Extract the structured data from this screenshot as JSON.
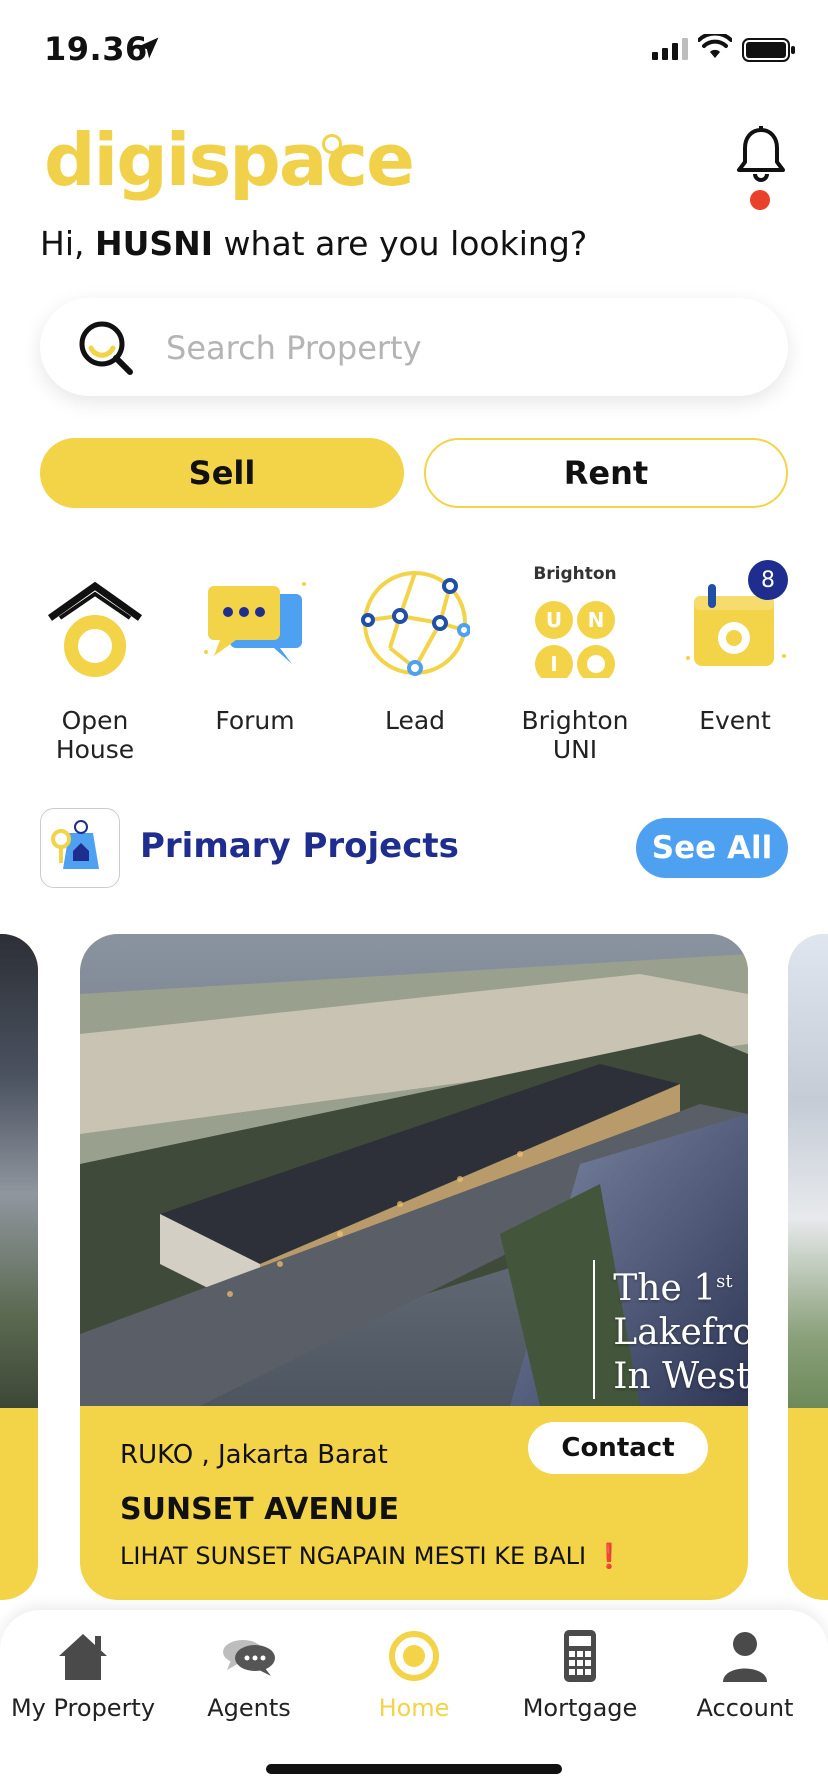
{
  "status_bar": {
    "time": "19.36"
  },
  "header": {
    "logo": "digispace",
    "greeting_prefix": "Hi, ",
    "user_name": "HUSNI",
    "greeting_suffix": " what are you looking?"
  },
  "search": {
    "placeholder": "Search Property"
  },
  "mode_toggle": {
    "sell": "Sell",
    "rent": "Rent",
    "selected": "sell"
  },
  "categories": [
    {
      "label": "Open House",
      "icon": "open-house-icon"
    },
    {
      "label": "Forum",
      "icon": "forum-icon"
    },
    {
      "label": "Lead",
      "icon": "lead-network-icon"
    },
    {
      "label": "Brighton UNI",
      "icon": "brighton-uni-icon",
      "logo_text": "Brighton",
      "letters": [
        "U",
        "N",
        "I"
      ]
    },
    {
      "label": "Event",
      "icon": "event-calendar-icon",
      "badge": "8"
    }
  ],
  "primary_projects": {
    "title": "Primary Projects",
    "see_all": "See All",
    "card": {
      "location": "RUKO , Jakarta Barat",
      "contact": "Contact",
      "title": "SUNSET AVENUE",
      "subtitle": "LIHAT SUNSET NGAPAIN MESTI KE BALI",
      "subtitle_mark": "❗",
      "image_text_line1": "The 1",
      "image_text_sup": "st",
      "image_text_line2": "Lakefro",
      "image_text_line3": "In West"
    }
  },
  "bottom_nav": [
    {
      "label": "My Property",
      "icon": "house-icon",
      "active": false
    },
    {
      "label": "Agents",
      "icon": "chat-bubbles-icon",
      "active": false
    },
    {
      "label": "Home",
      "icon": "home-target-icon",
      "active": true
    },
    {
      "label": "Mortgage",
      "icon": "calculator-icon",
      "active": false
    },
    {
      "label": "Account",
      "icon": "user-icon",
      "active": false
    }
  ],
  "colors": {
    "brand_yellow": "#f3d348",
    "brand_blue": "#1f2d8f",
    "see_all_blue": "#4ea0f0",
    "notification_red": "#e8412c"
  }
}
